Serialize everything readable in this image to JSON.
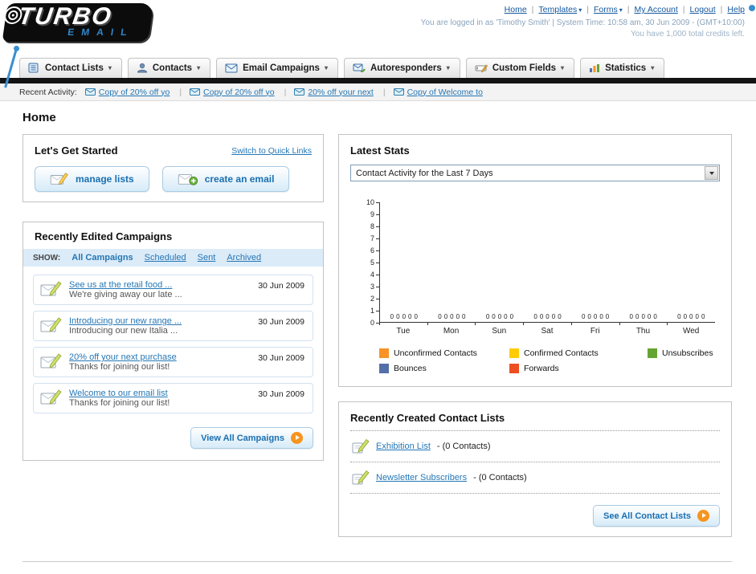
{
  "header": {
    "logo_main": "TURBO",
    "logo_sub": "EMAIL",
    "links": [
      {
        "label": "Home"
      },
      {
        "label": "Templates",
        "dropdown": true
      },
      {
        "label": "Forms",
        "dropdown": true
      },
      {
        "label": "My Account"
      },
      {
        "label": "Logout"
      },
      {
        "label": "Help"
      }
    ],
    "login_info": "You are logged in as 'Timothy Smith' | System Time: 10:58 am, 30 Jun 2009 - (GMT+10:00)",
    "credits_info": "You have 1,000 total credits left."
  },
  "nav": {
    "tabs": [
      {
        "label": "Contact Lists"
      },
      {
        "label": "Contacts"
      },
      {
        "label": "Email Campaigns"
      },
      {
        "label": "Autoresponders"
      },
      {
        "label": "Custom Fields"
      },
      {
        "label": "Statistics"
      }
    ]
  },
  "recent_activity": {
    "label": "Recent Activity:",
    "items": [
      {
        "label": "Copy of 20% off yo"
      },
      {
        "label": "Copy of 20% off yo"
      },
      {
        "label": "20% off your next"
      },
      {
        "label": "Copy of Welcome to"
      }
    ]
  },
  "page_title": "Home",
  "get_started": {
    "title": "Let's Get Started",
    "switch_link": "Switch to Quick Links",
    "manage_lists_label": "manage lists",
    "create_email_label": "create an email"
  },
  "campaigns": {
    "title": "Recently Edited Campaigns",
    "show_label": "SHOW:",
    "filters": [
      {
        "label": "All Campaigns",
        "active": true
      },
      {
        "label": "Scheduled"
      },
      {
        "label": "Sent"
      },
      {
        "label": "Archived"
      }
    ],
    "items": [
      {
        "title": "See us at the retail food ...",
        "subtitle": "We're giving away our late ...",
        "date": "30 Jun 2009"
      },
      {
        "title": "Introducing our new range ...",
        "subtitle": "Introducing our new Italia ...",
        "date": "30 Jun 2009"
      },
      {
        "title": "20% off your next purchase",
        "subtitle": "Thanks for joining our list!",
        "date": "30 Jun 2009"
      },
      {
        "title": "Welcome to our email list",
        "subtitle": "Thanks for joining our list!",
        "date": "30 Jun 2009"
      }
    ],
    "view_all_label": "View All Campaigns"
  },
  "stats": {
    "title": "Latest Stats",
    "dropdown_value": "Contact Activity for the Last 7 Days",
    "chart_data": {
      "type": "bar",
      "title": "Contact Activity for the Last 7 Days",
      "categories": [
        "Tue",
        "Mon",
        "Sun",
        "Sat",
        "Fri",
        "Thu",
        "Wed"
      ],
      "series": [
        {
          "name": "Unconfirmed Contacts",
          "color": "#F79327",
          "values": [
            0,
            0,
            0,
            0,
            0,
            0,
            0
          ]
        },
        {
          "name": "Confirmed Contacts",
          "color": "#FFCB05",
          "values": [
            0,
            0,
            0,
            0,
            0,
            0,
            0
          ]
        },
        {
          "name": "Unsubscribes",
          "color": "#64A433",
          "values": [
            0,
            0,
            0,
            0,
            0,
            0,
            0
          ]
        },
        {
          "name": "Bounces",
          "color": "#5470A8",
          "values": [
            0,
            0,
            0,
            0,
            0,
            0,
            0
          ]
        },
        {
          "name": "Forwards",
          "color": "#EE4F21",
          "values": [
            0,
            0,
            0,
            0,
            0,
            0,
            0
          ]
        }
      ],
      "ylim": [
        0,
        10
      ],
      "ytick_step": 1,
      "grid": false,
      "legend_position": "bottom"
    }
  },
  "contact_lists": {
    "title": "Recently Created Contact Lists",
    "items": [
      {
        "name": "Exhibition List",
        "detail": "- (0 Contacts)"
      },
      {
        "name": "Newsletter Subscribers",
        "detail": "- (0 Contacts)"
      }
    ],
    "see_all_label": "See All Contact Lists"
  },
  "colors": {
    "accent_blue": "#2577B5",
    "button_orange": "#F7941D",
    "logo_blue": "#2F86C8"
  }
}
